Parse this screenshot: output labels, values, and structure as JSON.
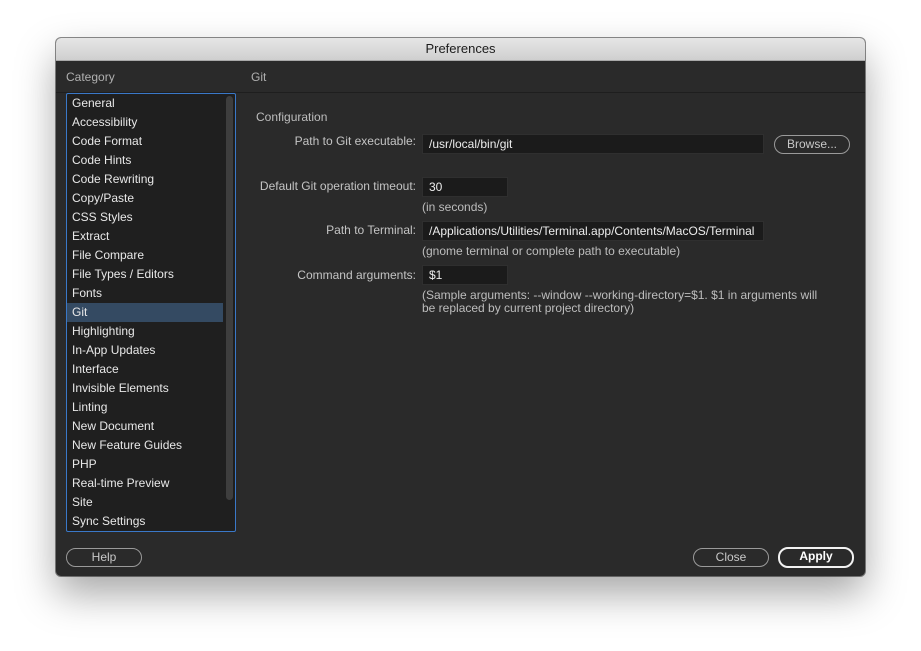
{
  "window": {
    "title": "Preferences"
  },
  "sidebar": {
    "heading": "Category",
    "selected": "Git",
    "items": [
      "General",
      "Accessibility",
      "Code Format",
      "Code Hints",
      "Code Rewriting",
      "Copy/Paste",
      "CSS Styles",
      "Extract",
      "File Compare",
      "File Types / Editors",
      "Fonts",
      "Git",
      "Highlighting",
      "In-App Updates",
      "Interface",
      "Invisible Elements",
      "Linting",
      "New Document",
      "New Feature Guides",
      "PHP",
      "Real-time Preview",
      "Site",
      "Sync Settings"
    ]
  },
  "panel": {
    "heading": "Git",
    "section_title": "Configuration",
    "git_path": {
      "label": "Path to Git executable:",
      "value": "/usr/local/bin/git",
      "browse_label": "Browse..."
    },
    "timeout": {
      "label": "Default Git operation timeout:",
      "value": "30",
      "hint": "(in seconds)"
    },
    "terminal": {
      "label": "Path to Terminal:",
      "value": "/Applications/Utilities/Terminal.app/Contents/MacOS/Terminal",
      "hint": "(gnome terminal or complete path to executable)"
    },
    "args": {
      "label": "Command arguments:",
      "value": "$1",
      "hint_line1": "(Sample arguments: --window --working-directory=$1. $1 in arguments will",
      "hint_line2": "be replaced by current project directory)"
    }
  },
  "footer": {
    "help_label": "Help",
    "close_label": "Close",
    "apply_label": "Apply"
  },
  "colors": {
    "selection": "#344a62",
    "focus_ring": "#3a78c8",
    "dialog_bg": "#2a2a2a"
  }
}
